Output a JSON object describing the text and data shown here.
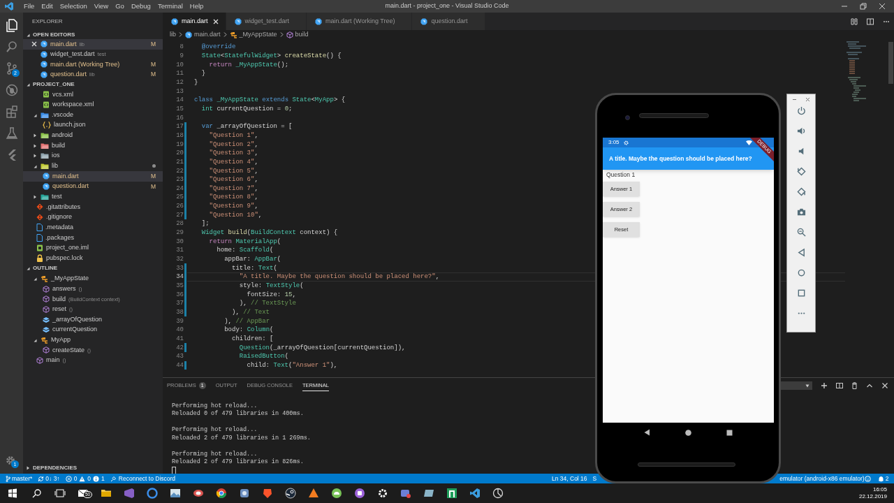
{
  "title_bar": {
    "menu": [
      "File",
      "Edit",
      "Selection",
      "View",
      "Go",
      "Debug",
      "Terminal",
      "Help"
    ],
    "title": "main.dart - project_one - Visual Studio Code"
  },
  "activity_bar": {
    "items": [
      {
        "selected": true
      },
      {
        "selected": false
      },
      {
        "selected": false,
        "badge": "2"
      },
      {
        "selected": false
      },
      {
        "selected": false
      },
      {
        "selected": false
      },
      {
        "selected": false
      }
    ],
    "settings_badge": "1"
  },
  "sidebar": {
    "title": "EXPLORER",
    "open_editors": {
      "title": "OPEN EDITORS",
      "expanded": true,
      "items": [
        {
          "label": "main.dart",
          "hint": "lib",
          "git_status": "M",
          "selected": true
        },
        {
          "label": "widget_test.dart",
          "hint": "test",
          "selected": false
        },
        {
          "label": "main.dart (Working Tree)",
          "git_status": "M",
          "selected": false
        },
        {
          "label": "question.dart",
          "hint": "lib",
          "git_status": "M",
          "selected": false
        }
      ]
    },
    "project": {
      "title": "PROJECT_ONE",
      "expanded": true,
      "items": [
        {
          "kind": "continuation",
          "children": [
            {
              "label": "vcs.xml",
              "kind": "xml",
              "selected": false
            },
            {
              "label": "workspace.xml",
              "kind": "xml",
              "selected": false
            }
          ]
        },
        {
          "label": ".vscode",
          "kind": "folder",
          "color": "#3b8eea",
          "expanded": true,
          "selected": false,
          "children": [
            {
              "label": "launch.json",
              "kind": "json",
              "selected": false
            }
          ]
        },
        {
          "label": "android",
          "kind": "folder",
          "color": "#8bc34a",
          "expanded": false,
          "selected": false
        },
        {
          "label": "build",
          "kind": "folder",
          "color": "#e57373",
          "expanded": false,
          "selected": false
        },
        {
          "label": "ios",
          "kind": "folder",
          "color": "#90a4ae",
          "expanded": false,
          "selected": false
        },
        {
          "label": "lib",
          "kind": "folder",
          "color": "#c0ca33",
          "expanded": true,
          "selected": false,
          "modified_dot": true,
          "children": [
            {
              "label": "main.dart",
              "kind": "dart",
              "git_status": "M",
              "selected": true
            },
            {
              "label": "question.dart",
              "kind": "dart",
              "git_status": "M",
              "selected": false
            }
          ]
        },
        {
          "label": "test",
          "kind": "folder",
          "color": "#26a69a",
          "expanded": false,
          "selected": false
        },
        {
          "label": ".gitattributes",
          "kind": "git",
          "selected": false
        },
        {
          "label": ".gitignore",
          "kind": "git",
          "selected": false
        },
        {
          "label": ".metadata",
          "kind": "file",
          "selected": false
        },
        {
          "label": ".packages",
          "kind": "file",
          "selected": false
        },
        {
          "label": "project_one.iml",
          "kind": "iml",
          "selected": false
        },
        {
          "label": "pubspec.lock",
          "kind": "lock",
          "selected": false
        }
      ]
    },
    "outline": {
      "title": "OUTLINE",
      "expanded": true,
      "items": [
        {
          "name": "_MyAppState",
          "kind": "class",
          "expanded": true,
          "children": [
            {
              "name": "answers",
              "detail": "()",
              "kind": "method"
            },
            {
              "name": "build",
              "detail": "(BuildContext context)",
              "kind": "method"
            },
            {
              "name": "reset",
              "detail": "()",
              "kind": "method"
            },
            {
              "name": "_arrayOfQuestion",
              "kind": "field"
            },
            {
              "name": "currentQuestion",
              "kind": "field"
            }
          ]
        },
        {
          "name": "MyApp",
          "kind": "class",
          "expanded": true,
          "children": [
            {
              "name": "createState",
              "detail": "()",
              "kind": "method"
            }
          ]
        },
        {
          "name": "main",
          "detail": "()",
          "kind": "method"
        }
      ]
    },
    "dependencies": {
      "title": "DEPENDENCIES",
      "expanded": false
    }
  },
  "editor": {
    "tabs": [
      {
        "label": "main.dart",
        "selected": true
      },
      {
        "label": "widget_test.dart",
        "selected": false
      },
      {
        "label": "main.dart (Working Tree)",
        "selected": false
      },
      {
        "label": "question.dart",
        "selected": false
      }
    ],
    "breadcrumb": [
      {
        "label": "lib",
        "kind": "folder"
      },
      {
        "label": "main.dart",
        "kind": "dart"
      },
      {
        "label": "_MyAppState",
        "kind": "class"
      },
      {
        "label": "build",
        "kind": "method"
      }
    ],
    "lines": [
      {
        "number": "8",
        "modified": false,
        "current": false,
        "segments": [
          {
            "kind": "keyword",
            "text": "  @override"
          }
        ]
      },
      {
        "number": "9",
        "modified": false,
        "current": false,
        "segments": [
          {
            "kind": "type",
            "text": "  State"
          },
          {
            "kind": "plain",
            "text": "<"
          },
          {
            "kind": "type",
            "text": "StatefulWidget"
          },
          {
            "kind": "plain",
            "text": ">"
          },
          {
            "kind": "function",
            "text": " createState"
          },
          {
            "kind": "plain",
            "text": "() {"
          }
        ]
      },
      {
        "number": "10",
        "modified": false,
        "current": false,
        "segments": [
          {
            "kind": "control",
            "text": "    return"
          },
          {
            "kind": "type",
            "text": " _MyAppState"
          },
          {
            "kind": "plain",
            "text": "();"
          }
        ]
      },
      {
        "number": "11",
        "modified": false,
        "current": false,
        "segments": [
          {
            "kind": "plain",
            "text": "  }"
          }
        ]
      },
      {
        "number": "12",
        "modified": false,
        "current": false,
        "segments": [
          {
            "kind": "plain",
            "text": "}"
          }
        ]
      },
      {
        "number": "13",
        "modified": false,
        "current": false
      },
      {
        "number": "14",
        "modified": false,
        "current": false,
        "segments": [
          {
            "kind": "keyword",
            "text": "class"
          },
          {
            "kind": "type",
            "text": " _MyAppState"
          },
          {
            "kind": "keyword",
            "text": " extends"
          },
          {
            "kind": "type",
            "text": " State"
          },
          {
            "kind": "plain",
            "text": "<"
          },
          {
            "kind": "type",
            "text": "MyApp"
          },
          {
            "kind": "plain",
            "text": "> {"
          }
        ]
      },
      {
        "number": "15",
        "modified": false,
        "current": false,
        "segments": [
          {
            "kind": "type",
            "text": "  int"
          },
          {
            "kind": "plain",
            "text": " currentQuestion = "
          },
          {
            "kind": "number",
            "text": "0"
          },
          {
            "kind": "plain",
            "text": ";"
          }
        ]
      },
      {
        "number": "16",
        "modified": false,
        "current": false
      },
      {
        "number": "17",
        "modified": true,
        "current": false,
        "segments": [
          {
            "kind": "keyword",
            "text": "  var"
          },
          {
            "kind": "plain",
            "text": " _arrayOfQuestion = ["
          }
        ]
      },
      {
        "number": "18",
        "modified": true,
        "current": false,
        "segments": [
          {
            "kind": "string",
            "text": "    \"Question 1\""
          },
          {
            "kind": "plain",
            "text": ","
          }
        ]
      },
      {
        "number": "19",
        "modified": true,
        "current": false,
        "segments": [
          {
            "kind": "string",
            "text": "    \"Question 2\""
          },
          {
            "kind": "plain",
            "text": ","
          }
        ]
      },
      {
        "number": "20",
        "modified": true,
        "current": false,
        "segments": [
          {
            "kind": "string",
            "text": "    \"Question 3\""
          },
          {
            "kind": "plain",
            "text": ","
          }
        ]
      },
      {
        "number": "21",
        "modified": true,
        "current": false,
        "segments": [
          {
            "kind": "string",
            "text": "    \"Question 4\""
          },
          {
            "kind": "plain",
            "text": ","
          }
        ]
      },
      {
        "number": "22",
        "modified": true,
        "current": false,
        "segments": [
          {
            "kind": "string",
            "text": "    \"Question 5\""
          },
          {
            "kind": "plain",
            "text": ","
          }
        ]
      },
      {
        "number": "23",
        "modified": true,
        "current": false,
        "segments": [
          {
            "kind": "string",
            "text": "    \"Question 6\""
          },
          {
            "kind": "plain",
            "text": ","
          }
        ]
      },
      {
        "number": "24",
        "modified": true,
        "current": false,
        "segments": [
          {
            "kind": "string",
            "text": "    \"Question 7\""
          },
          {
            "kind": "plain",
            "text": ","
          }
        ]
      },
      {
        "number": "25",
        "modified": true,
        "current": false,
        "segments": [
          {
            "kind": "string",
            "text": "    \"Question 8\""
          },
          {
            "kind": "plain",
            "text": ","
          }
        ]
      },
      {
        "number": "26",
        "modified": true,
        "current": false,
        "segments": [
          {
            "kind": "string",
            "text": "    \"Question 9\""
          },
          {
            "kind": "plain",
            "text": ","
          }
        ]
      },
      {
        "number": "27",
        "modified": true,
        "current": false,
        "segments": [
          {
            "kind": "string",
            "text": "    \"Question 10\""
          },
          {
            "kind": "plain",
            "text": ","
          }
        ]
      },
      {
        "number": "28",
        "modified": false,
        "current": false,
        "segments": [
          {
            "kind": "plain",
            "text": "  ];"
          }
        ]
      },
      {
        "number": "29",
        "modified": false,
        "current": false,
        "segments": [
          {
            "kind": "type",
            "text": "  Widget"
          },
          {
            "kind": "function",
            "text": " build"
          },
          {
            "kind": "plain",
            "text": "("
          },
          {
            "kind": "type",
            "text": "BuildContext"
          },
          {
            "kind": "plain",
            "text": " context) {"
          }
        ]
      },
      {
        "number": "30",
        "modified": false,
        "current": false,
        "segments": [
          {
            "kind": "control",
            "text": "    return"
          },
          {
            "kind": "type",
            "text": " MaterialApp"
          },
          {
            "kind": "plain",
            "text": "("
          }
        ]
      },
      {
        "number": "31",
        "modified": false,
        "current": false,
        "segments": [
          {
            "kind": "plain",
            "text": "      home: "
          },
          {
            "kind": "type",
            "text": "Scaffold"
          },
          {
            "kind": "plain",
            "text": "("
          }
        ]
      },
      {
        "number": "32",
        "modified": false,
        "current": false,
        "segments": [
          {
            "kind": "plain",
            "text": "        appBar: "
          },
          {
            "kind": "type",
            "text": "AppBar"
          },
          {
            "kind": "plain",
            "text": "("
          }
        ]
      },
      {
        "number": "33",
        "modified": true,
        "current": false,
        "segments": [
          {
            "kind": "plain",
            "text": "          title: "
          },
          {
            "kind": "type",
            "text": "Text"
          },
          {
            "kind": "plain",
            "text": "("
          }
        ]
      },
      {
        "number": "34",
        "modified": true,
        "current": true,
        "segments": [
          {
            "kind": "string",
            "text": "            \"A title. Maybe the question should be placed here?\""
          },
          {
            "kind": "plain",
            "text": ","
          }
        ]
      },
      {
        "number": "35",
        "modified": true,
        "current": false,
        "segments": [
          {
            "kind": "plain",
            "text": "            style: "
          },
          {
            "kind": "type",
            "text": "TextStyle"
          },
          {
            "kind": "plain",
            "text": "("
          }
        ]
      },
      {
        "number": "36",
        "modified": true,
        "current": false,
        "segments": [
          {
            "kind": "plain",
            "text": "              fontSize: "
          },
          {
            "kind": "number",
            "text": "15"
          },
          {
            "kind": "plain",
            "text": ","
          }
        ]
      },
      {
        "number": "37",
        "modified": true,
        "current": false,
        "segments": [
          {
            "kind": "plain",
            "text": "            ), "
          },
          {
            "kind": "comment",
            "text": "// TextStyle"
          }
        ]
      },
      {
        "number": "38",
        "modified": true,
        "current": false,
        "segments": [
          {
            "kind": "plain",
            "text": "          ), "
          },
          {
            "kind": "comment",
            "text": "// Text"
          }
        ]
      },
      {
        "number": "39",
        "modified": false,
        "current": false,
        "segments": [
          {
            "kind": "plain",
            "text": "        ), "
          },
          {
            "kind": "comment",
            "text": "// AppBar"
          }
        ]
      },
      {
        "number": "40",
        "modified": false,
        "current": false,
        "segments": [
          {
            "kind": "plain",
            "text": "        body: "
          },
          {
            "kind": "type",
            "text": "Column"
          },
          {
            "kind": "plain",
            "text": "("
          }
        ]
      },
      {
        "number": "41",
        "modified": false,
        "current": false,
        "segments": [
          {
            "kind": "plain",
            "text": "          children: ["
          }
        ]
      },
      {
        "number": "42",
        "modified": true,
        "current": false,
        "segments": [
          {
            "kind": "type",
            "text": "            Question"
          },
          {
            "kind": "plain",
            "text": "(_arrayOfQuestion[currentQuestion]),"
          }
        ]
      },
      {
        "number": "43",
        "modified": false,
        "current": false,
        "segments": [
          {
            "kind": "type",
            "text": "            RaisedButton"
          },
          {
            "kind": "plain",
            "text": "("
          }
        ]
      },
      {
        "number": "44",
        "modified": true,
        "current": false,
        "segments": [
          {
            "kind": "plain",
            "text": "              child: "
          },
          {
            "kind": "type",
            "text": "Text"
          },
          {
            "kind": "plain",
            "text": "("
          },
          {
            "kind": "string",
            "text": "\"Answer 1\""
          },
          {
            "kind": "plain",
            "text": "),"
          }
        ]
      }
    ]
  },
  "panel": {
    "tabs": [
      {
        "label": "PROBLEMS",
        "badge": "1",
        "selected": false
      },
      {
        "label": "OUTPUT",
        "selected": false
      },
      {
        "label": "DEBUG CONSOLE",
        "selected": false
      },
      {
        "label": "TERMINAL",
        "selected": true
      }
    ],
    "terminal": [
      [
        "Performing hot reload...",
        "Reloaded 0 of 479 libraries in 400ms."
      ],
      [
        "Performing hot reload...",
        "Reloaded 2 of 479 libraries in 1 269ms."
      ],
      [
        "Performing hot reload...",
        "Reloaded 2 of 479 libraries in 826ms."
      ]
    ]
  },
  "status_bar": {
    "branch": "master*",
    "sync": "0↓ 3↑",
    "errors": "0",
    "warnings": "0",
    "infos": "1",
    "discord": "Reconnect to Discord",
    "position": "Ln 34, Col 16",
    "indent": "S",
    "device": "emulator (android-x86 emulator)",
    "notifications": "2"
  },
  "phone": {
    "time": "3:05",
    "banner": "DEBUG",
    "app_title": "A title. Maybe the question should be placed here?",
    "question": "Question 1",
    "buttons": [
      "Answer 1",
      "Answer 2",
      "Reset"
    ]
  },
  "taskbar": {
    "mail_badge": "50",
    "time": "16:05",
    "date": "22.12.2019"
  }
}
